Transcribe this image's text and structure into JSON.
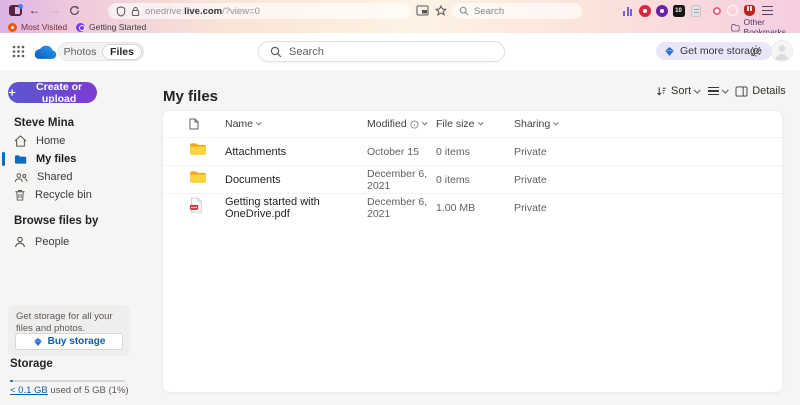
{
  "browser": {
    "url": {
      "prefix": "onedrive.",
      "domain": "live.com",
      "path": "/?view=0"
    },
    "search_placeholder": "Search",
    "bookmarks_bar": {
      "most_visited": "Most Visited",
      "getting_started": "Getting Started",
      "other_bookmarks": "Other Bookmarks"
    },
    "extension_badge": "10",
    "extension_icons": [
      "stats-bars-icon",
      "red-circle-icon",
      "purple-circle-icon",
      "badge-10-icon",
      "notes-icon",
      "pink-dot-icon",
      "white-ring-icon",
      "red-hand-icon",
      "menu-icon"
    ]
  },
  "onedrive_header": {
    "toggle": {
      "photos_label": "Photos",
      "files_label": "Files"
    },
    "search_placeholder": "Search",
    "get_more_storage_label": "Get more storage"
  },
  "sidebar": {
    "create_button_label": "Create or upload",
    "account_name": "Steve Mina",
    "nav": [
      {
        "label": "Home"
      },
      {
        "label": "My files",
        "selected": true
      },
      {
        "label": "Shared"
      },
      {
        "label": "Recycle bin"
      }
    ],
    "browse_section_label": "Browse files by",
    "browse_nav": [
      {
        "label": "People"
      }
    ],
    "promo_text": "Get storage for all your files and photos.",
    "buy_storage_label": "Buy storage",
    "storage_title": "Storage",
    "storage_used_link": "< 0.1 GB",
    "storage_usage_text": " used of 5 GB (1%)",
    "storage_percent_used": 1
  },
  "main": {
    "title": "My files",
    "toolbar": {
      "sort_label": "Sort",
      "details_label": "Details"
    },
    "table": {
      "headers": {
        "name": "Name",
        "modified": "Modified",
        "file_size": "File size",
        "sharing": "Sharing"
      },
      "rows": [
        {
          "name": "Attachments",
          "icon": "folder",
          "modified": "October 15",
          "file_size": "0 items",
          "sharing": "Private"
        },
        {
          "name": "Documents",
          "icon": "folder",
          "modified": "December 6, 2021",
          "file_size": "0 items",
          "sharing": "Private"
        },
        {
          "name": "Getting started with OneDrive.pdf",
          "icon": "pdf-file",
          "modified": "December 6, 2021",
          "file_size": "1.00 MB",
          "sharing": "Private"
        }
      ]
    }
  },
  "colors": {
    "accent_blue": "#0f6cbd",
    "link_blue": "#0b5cab",
    "folder_yellow": "#ffd43d",
    "pdf_red": "#d13438",
    "premium_diamond_blue": "#2a6fdb",
    "create_button_gradient": [
      "#5a57d0",
      "#7d3bd2"
    ]
  }
}
